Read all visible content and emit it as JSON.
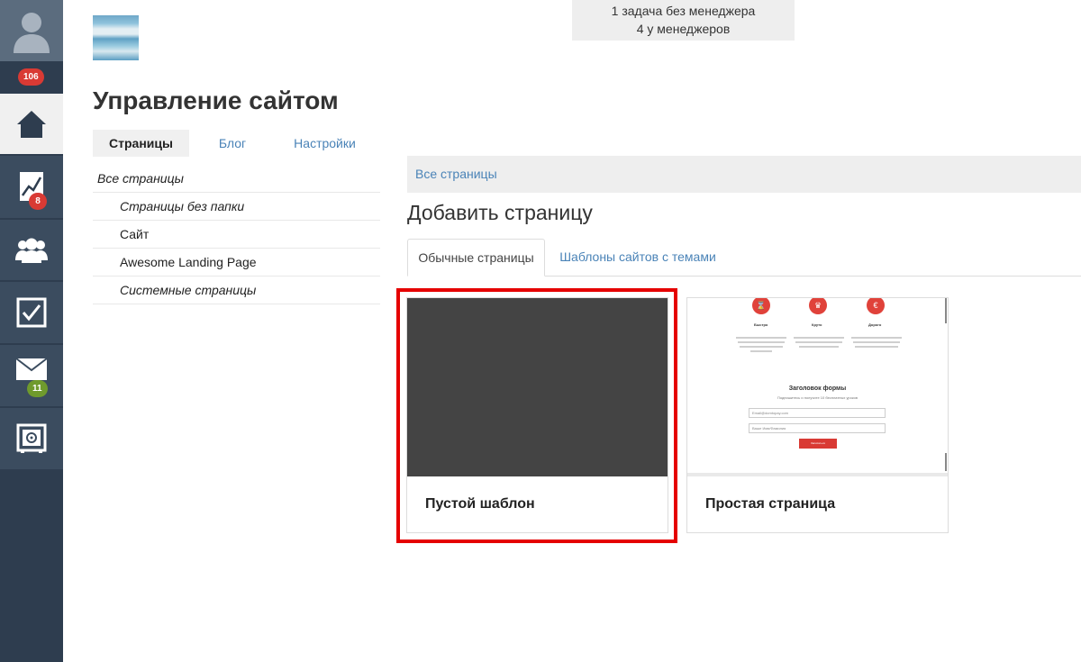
{
  "sidebar": {
    "badges": {
      "profile": "106",
      "stats": "8",
      "mail": "11"
    },
    "items": [
      {
        "name": "home-icon"
      },
      {
        "name": "chart-icon"
      },
      {
        "name": "users-icon"
      },
      {
        "name": "checkbox-icon"
      },
      {
        "name": "mail-icon"
      },
      {
        "name": "safe-icon"
      }
    ]
  },
  "header": {
    "notice_line1": "1 задача без менеджера",
    "notice_line2": "4 у менеджеров",
    "title": "Управление сайтом",
    "tabs": [
      "Страницы",
      "Блог",
      "Настройки"
    ]
  },
  "folders": [
    "Все страницы",
    "Страницы без папки",
    "Сайт",
    "Awesome Landing Page",
    "Системные страницы"
  ],
  "content": {
    "breadcrumb": "Все страницы",
    "title": "Добавить страницу",
    "subtabs": [
      "Обычные страницы",
      "Шаблоны сайтов с темами"
    ],
    "cards": [
      {
        "label": "Пустой шаблон"
      },
      {
        "label": "Простая страница"
      }
    ],
    "preview": {
      "features": [
        "Быстро",
        "Круто",
        "Дорого"
      ],
      "icon_symbols": [
        "⌛",
        "♛",
        "€"
      ],
      "form_title": "Заголовок формы",
      "form_sub": "Подпишитесь и получите 10 бесплатных уроков",
      "field1": "Email@domtopay.com",
      "field2": "Ваше Имя/Фамилия",
      "button": "Записаться"
    }
  },
  "colors": {
    "sidebar_bg": "#2e3d4f",
    "link": "#4a83b7",
    "highlight": "#e50000",
    "badge_red": "#d93a34",
    "badge_green": "#6f9a2d"
  }
}
